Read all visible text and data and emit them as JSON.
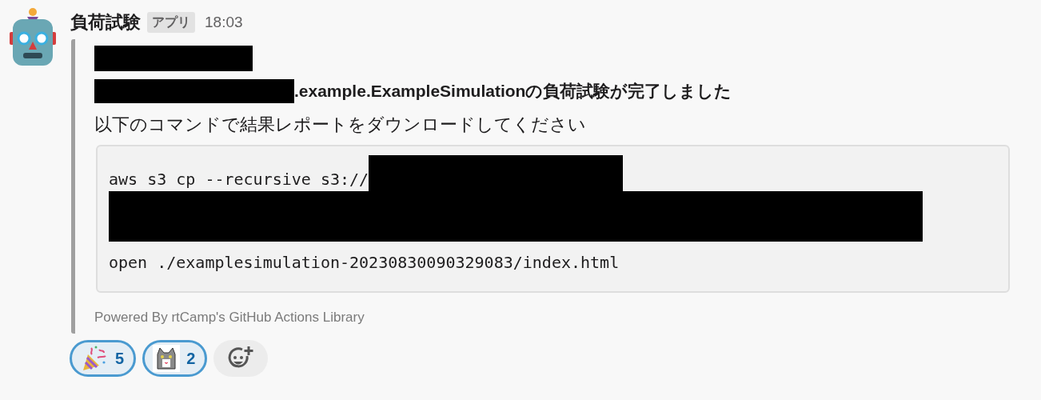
{
  "message": {
    "sender": "負荷試験",
    "badge": "アプリ",
    "time": "18:03",
    "lines": [
      {
        "segments": [
          {
            "kind": "redacted"
          }
        ]
      },
      {
        "bold": true,
        "segments": [
          {
            "kind": "redacted"
          },
          {
            "kind": "text",
            "text": ".example.ExampleSimulationの負荷試験が完了しました"
          }
        ]
      },
      {
        "bold": false,
        "segments": [
          {
            "kind": "text",
            "text": "以下のコマンドで結果レポートをダウンロードしてください"
          }
        ]
      }
    ],
    "code_lines": [
      {
        "segments": [
          {
            "kind": "text",
            "text": "aws s3 cp --recursive s3://"
          },
          {
            "kind": "redacted"
          }
        ]
      },
      {
        "segments": [
          {
            "kind": "redacted"
          }
        ]
      },
      {
        "segments": [
          {
            "kind": "text",
            "text": "open ./examplesimulation-20230830090329083/index.html"
          }
        ]
      }
    ],
    "footer": "Powered By rtCamp's GitHub Actions Library"
  },
  "reactions": [
    {
      "kind": "party",
      "count": "5",
      "selected": true
    },
    {
      "kind": "cat",
      "count": "2",
      "selected": true
    }
  ]
}
